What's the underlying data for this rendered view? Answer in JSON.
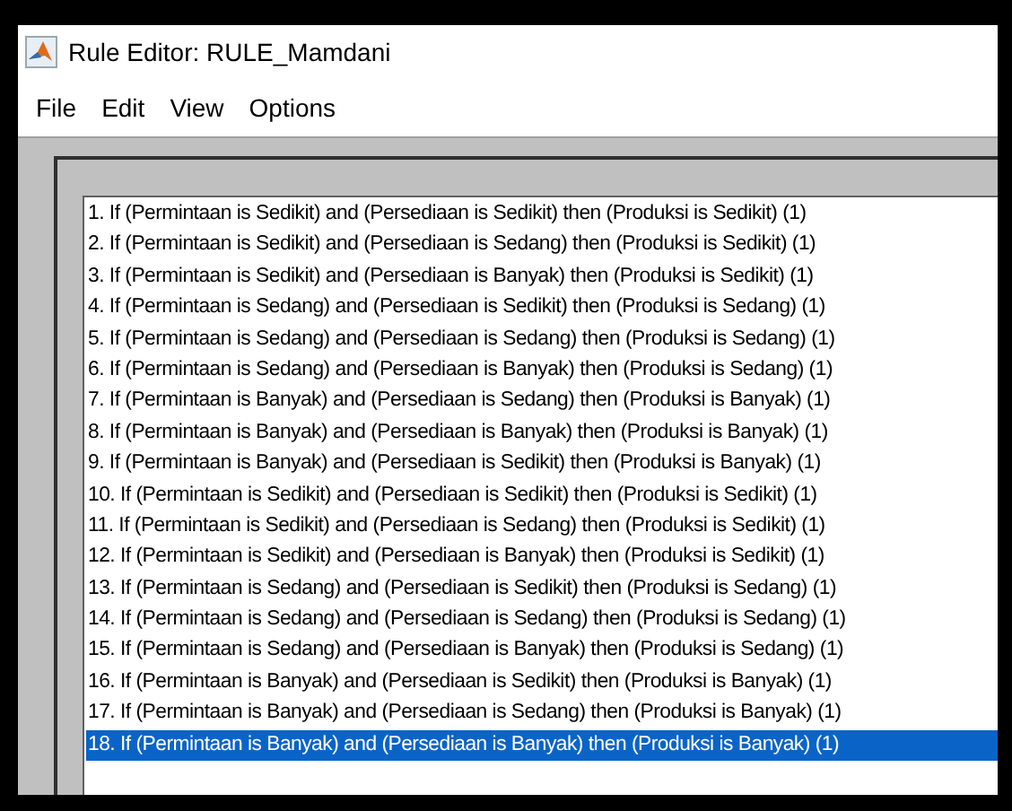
{
  "window": {
    "title": "Rule Editor: RULE_Mamdani"
  },
  "menu": [
    "File",
    "Edit",
    "View",
    "Options"
  ],
  "rules": [
    {
      "text": "1. If (Permintaan is Sedikit) and (Persediaan is Sedikit) then (Produksi is Sedikit) (1)",
      "selected": false
    },
    {
      "text": "2. If (Permintaan is Sedikit) and (Persediaan is Sedang) then (Produksi is Sedikit) (1)",
      "selected": false
    },
    {
      "text": "3. If (Permintaan is Sedikit) and (Persediaan is Banyak) then (Produksi is Sedikit) (1)",
      "selected": false
    },
    {
      "text": "4. If (Permintaan is Sedang) and (Persediaan is Sedikit) then (Produksi is Sedang) (1)",
      "selected": false
    },
    {
      "text": "5. If (Permintaan is Sedang) and (Persediaan is Sedang) then (Produksi is Sedang) (1)",
      "selected": false
    },
    {
      "text": "6. If (Permintaan is Sedang) and (Persediaan is Banyak) then (Produksi is Sedang) (1)",
      "selected": false
    },
    {
      "text": "7. If (Permintaan is Banyak) and (Persediaan is Sedang) then (Produksi is Banyak) (1)",
      "selected": false
    },
    {
      "text": "8. If (Permintaan is Banyak) and (Persediaan is Banyak) then (Produksi is Banyak) (1)",
      "selected": false
    },
    {
      "text": "9. If (Permintaan is Banyak) and (Persediaan is Sedikit) then (Produksi is Banyak) (1)",
      "selected": false
    },
    {
      "text": "10. If (Permintaan is Sedikit) and (Persediaan is Sedikit) then (Produksi is Sedikit) (1)",
      "selected": false
    },
    {
      "text": "11. If (Permintaan is Sedikit) and (Persediaan is Sedang) then (Produksi is Sedikit) (1)",
      "selected": false
    },
    {
      "text": "12. If (Permintaan is Sedikit) and (Persediaan is Banyak) then (Produksi is Sedikit) (1)",
      "selected": false
    },
    {
      "text": "13. If (Permintaan is Sedang) and (Persediaan is Sedikit) then (Produksi is Sedang) (1)",
      "selected": false
    },
    {
      "text": "14. If (Permintaan is Sedang) and (Persediaan is Sedang) then (Produksi is Sedang) (1)",
      "selected": false
    },
    {
      "text": "15. If (Permintaan is Sedang) and (Persediaan is Banyak) then (Produksi is Sedang) (1)",
      "selected": false
    },
    {
      "text": "16. If (Permintaan is Banyak) and (Persediaan is Sedikit) then (Produksi is Banyak) (1)",
      "selected": false
    },
    {
      "text": "17. If (Permintaan is Banyak) and (Persediaan is Sedang) then (Produksi is Banyak) (1)",
      "selected": false
    },
    {
      "text": "18. If (Permintaan is Banyak) and (Persediaan is Banyak) then (Produksi is Banyak) (1)",
      "selected": true
    }
  ]
}
